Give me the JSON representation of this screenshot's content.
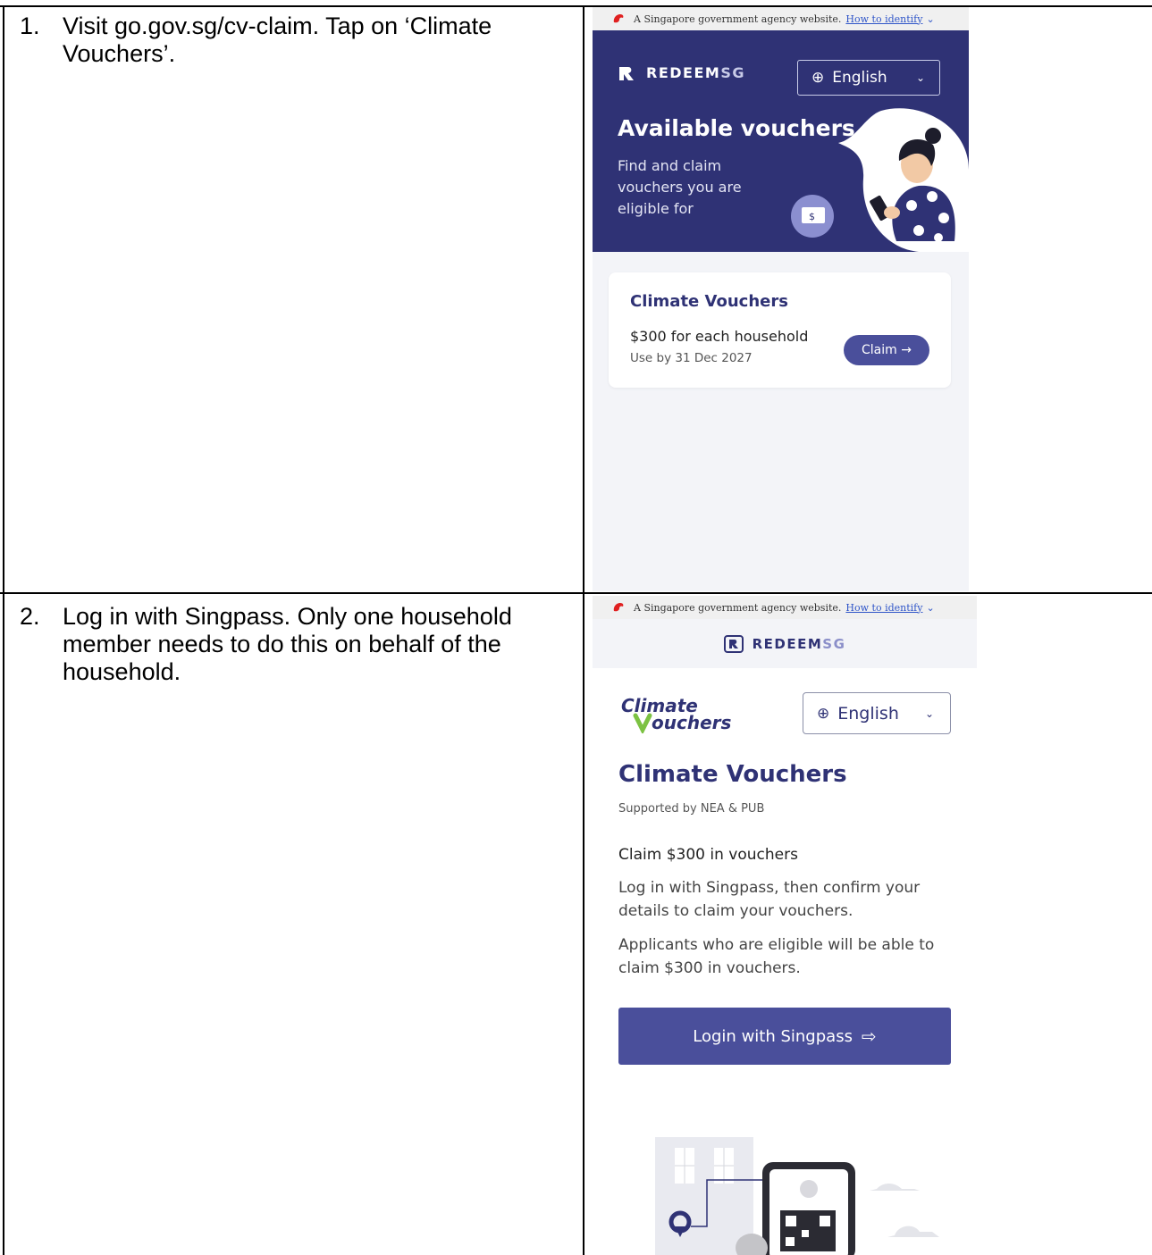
{
  "steps": [
    {
      "number": "1.",
      "text": "Visit go.gov.sg/cv-claim. Tap on ‘Climate Vouchers’."
    },
    {
      "number": "2.",
      "text": "Log in with Singpass. Only one household member needs to do this on behalf of the household."
    }
  ],
  "gov_banner": {
    "text": "A Singapore government agency website.",
    "link": "How to identify",
    "chevron_icon": "chevron-down-icon",
    "emblem_icon": "lion-head-icon"
  },
  "screen1": {
    "logo_main": "REDEEM",
    "logo_accent": "SG",
    "language": "English",
    "heading": "Available vouchers",
    "subtitle": "Find and claim vouchers you are eligible for",
    "card": {
      "title": "Climate Vouchers",
      "amount": "$300 for each household",
      "expiry": "Use by 31 Dec 2027",
      "button": "Claim →"
    },
    "colors": {
      "hero": "#2f3275",
      "button": "#4a4f9b",
      "page_bg": "#f3f4f8"
    }
  },
  "screen2": {
    "logo_main": "REDEEM",
    "logo_accent": "SG",
    "brand_logo_line1": "Climate",
    "brand_logo_line2": "ouchers",
    "language": "English",
    "title": "Climate Vouchers",
    "supported": "Supported by NEA & PUB",
    "claim_heading": "Claim $300 in vouchers",
    "para1": "Log in with Singpass, then confirm your details to claim your vouchers.",
    "para2": "Applicants who are eligible will be able to claim $300 in vouchers.",
    "login_button": "Login with Singpass",
    "login_icon": "login-arrow-icon",
    "colors": {
      "title": "#2f3275",
      "button": "#4a4f9b",
      "logo_green": "#7cc242"
    }
  }
}
